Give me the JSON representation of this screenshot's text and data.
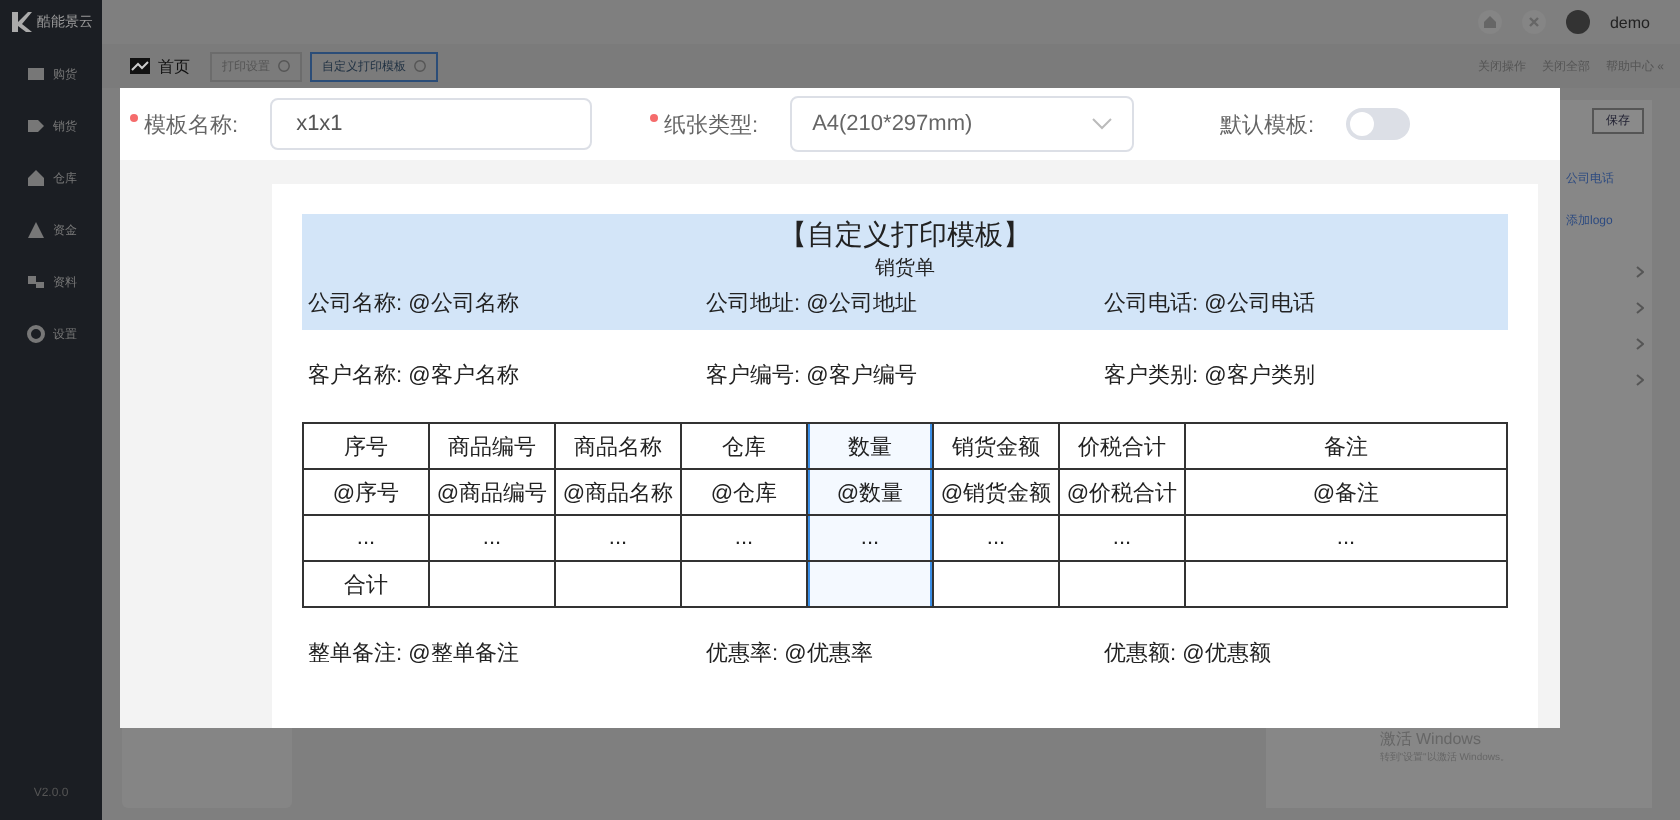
{
  "app": {
    "logo": "酷能景云",
    "version": "V2.0.0"
  },
  "sidebar": {
    "items": [
      {
        "label": "购货"
      },
      {
        "label": "销货"
      },
      {
        "label": "仓库"
      },
      {
        "label": "资金"
      },
      {
        "label": "资料"
      },
      {
        "label": "设置"
      }
    ]
  },
  "header": {
    "user": "demo"
  },
  "tabs": [
    {
      "label": "首页",
      "selected": false,
      "closable": false
    },
    {
      "label": "打印设置",
      "selected": false,
      "closable": true
    },
    {
      "label": "自定义打印模板",
      "selected": true,
      "closable": true
    }
  ],
  "tab_actions": [
    "关闭操作",
    "关闭全部",
    "帮助中心 «"
  ],
  "right_panel": {
    "button": "保存",
    "links": [
      "公司电话",
      "添加logo"
    ]
  },
  "os_notice": {
    "title": "激活 Windows",
    "text": "转到\"设置\"以激活 Windows。"
  },
  "dialog": {
    "fields": [
      {
        "kind": "text",
        "label": "模板名称:",
        "required": true,
        "value": "x1x1"
      },
      {
        "kind": "select",
        "label": "纸张类型:",
        "required": true,
        "value": "A4(210*297mm)"
      },
      {
        "kind": "switch",
        "label": "默认模板:",
        "required": false,
        "on": false
      }
    ],
    "template": {
      "title": "【自定义打印模板】",
      "subtitle": "销货单",
      "company": [
        "公司名称: @公司名称",
        "公司地址: @公司地址",
        "公司电话: @公司电话"
      ],
      "customer": [
        "客户名称: @客户名称",
        "客户编号: @客户编号",
        "客户类别: @客户类别"
      ],
      "table": {
        "columns": [
          {
            "label": "序号",
            "selected": false
          },
          {
            "label": "商品编号",
            "selected": false
          },
          {
            "label": "商品名称",
            "selected": false
          },
          {
            "label": "仓库",
            "selected": false
          },
          {
            "label": "数量",
            "selected": true
          },
          {
            "label": "销货金额",
            "selected": false
          },
          {
            "label": "价税合计",
            "selected": false
          },
          {
            "label": "备注",
            "selected": false
          }
        ],
        "rows": [
          [
            "@序号",
            "@商品编号",
            "@商品名称",
            "@仓库",
            "@数量",
            "@销货金额",
            "@价税合计",
            "@备注"
          ],
          [
            "...",
            "...",
            "...",
            "...",
            "...",
            "...",
            "...",
            "..."
          ],
          [
            "合计",
            "",
            "",
            "",
            "",
            "",
            "",
            ""
          ]
        ]
      },
      "footer": [
        "整单备注: @整单备注",
        "优惠率: @优惠率",
        "优惠额: @优惠额"
      ]
    }
  }
}
